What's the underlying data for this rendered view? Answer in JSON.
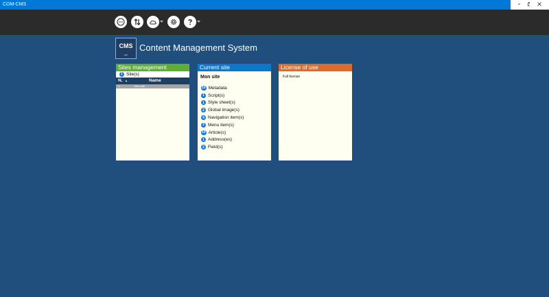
{
  "window": {
    "title": "COM-CMS"
  },
  "toolbar": {
    "icons": [
      "more-icon",
      "sync-icon",
      "cloud-icon",
      "gear-icon",
      "help-icon"
    ]
  },
  "header": {
    "logo_text": "CMS",
    "logo_subtext": "web",
    "title": "Content Management System"
  },
  "sites_panel": {
    "title": "Sites management",
    "sites_count": "1",
    "sites_label": "Site(s)",
    "columns": {
      "n": "N.",
      "name": "Name"
    },
    "rows": [
      {
        "n": "1",
        "name": "Mon site"
      }
    ]
  },
  "current_panel": {
    "title": "Current site",
    "site_name": "Mon site",
    "stats": [
      {
        "count": "10",
        "label": "Metadata"
      },
      {
        "count": "1",
        "label": "Script(s)"
      },
      {
        "count": "1",
        "label": "Style sheet(s)"
      },
      {
        "count": "2",
        "label": "Global image(s)"
      },
      {
        "count": "4",
        "label": "Navigation item(s)"
      },
      {
        "count": "2",
        "label": "Menu item(s)"
      },
      {
        "count": "10",
        "label": "Article(s)"
      },
      {
        "count": "1",
        "label": "Address(es)"
      },
      {
        "count": "2",
        "label": "Field(s)"
      }
    ]
  },
  "license_panel": {
    "title": "License of use",
    "text": "Full license"
  },
  "colors": {
    "background": "#204f7e",
    "titlebar": "#0078d7",
    "toolbar": "#2b2b2b",
    "sites_header": "#60ad35",
    "current_header": "#0b79c7",
    "license_header": "#de6b2c",
    "panel_bg": "#fefff0",
    "badge": "#1976d2"
  }
}
